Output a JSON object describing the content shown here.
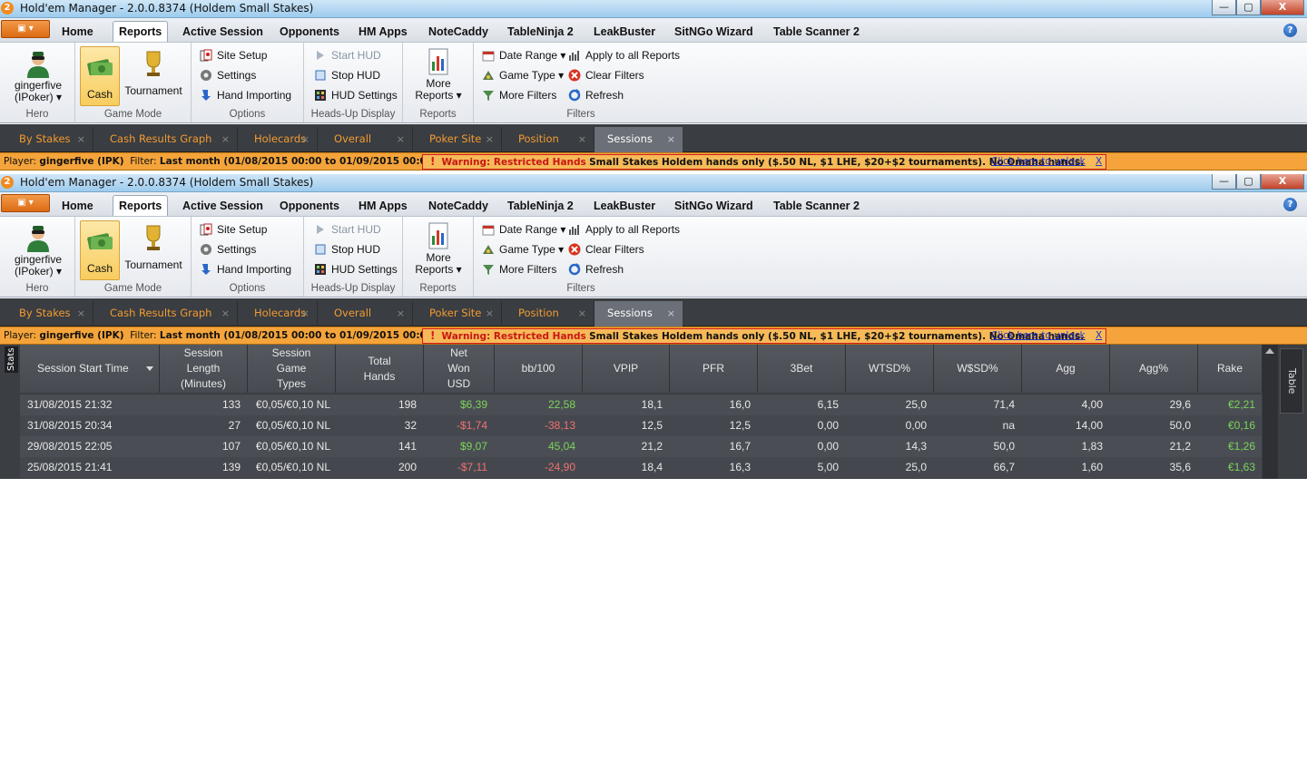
{
  "window": {
    "app_icon": "2",
    "title": "Hold'em Manager - 2.0.0.8374 (Holdem Small Stakes)",
    "minimize": "—",
    "maximize": "▢",
    "close": "X"
  },
  "menu": {
    "app_button": "▣ ▾",
    "tabs": [
      "Home",
      "Reports",
      "Active Session",
      "Opponents",
      "HM Apps",
      "NoteCaddy",
      "TableNinja 2",
      "LeakBuster",
      "SitNGo Wizard",
      "Table Scanner 2"
    ],
    "selected_tab": "Reports",
    "help": "?"
  },
  "ribbon": {
    "hero": {
      "name_line1": "gingerfive",
      "name_line2": "(IPoker) ▾",
      "label": "Hero"
    },
    "game_mode": {
      "cash": "Cash",
      "tournament": "Tournament",
      "label": "Game Mode"
    },
    "options": {
      "site_setup": "Site Setup",
      "settings": "Settings",
      "hand_importing": "Hand Importing",
      "label": "Options"
    },
    "hud": {
      "start_hud": "Start HUD",
      "stop_hud": "Stop HUD",
      "hud_settings": "HUD Settings",
      "label": "Heads-Up Display"
    },
    "reports": {
      "more_line1": "More",
      "more_line2": "Reports ▾",
      "label": "Reports"
    },
    "filters": {
      "date_range": "Date Range ▾",
      "game_type": "Game Type ▾",
      "more_filters": "More Filters",
      "apply_all": "Apply to all Reports",
      "clear_filters": "Clear Filters",
      "refresh": "Refresh",
      "label": "Filters"
    }
  },
  "doc_tabs": [
    "By Stakes",
    "Cash Results Graph",
    "Holecards",
    "Overall",
    "Poker Site",
    "Position",
    "Sessions"
  ],
  "doc_tab_close": "×",
  "filter_bar": {
    "player_label": "Player:",
    "player": "gingerfive (IPK)",
    "filter_label": "Filter:",
    "filter": "Last month (01/08/2015 00:00 to 01/09/2015 00:00)",
    "warn_icon": "!",
    "warning_title": "Warning: Restricted Hands",
    "warning_text": "Small Stakes Holdem hands only ($.50 NL, $1 LHE, $20+$2 tournaments).  No Omaha hands.",
    "unlock_link": "Click here to unlock",
    "dismiss": "X"
  },
  "grid": {
    "stats_tab": "Stats",
    "table_tab": "Table",
    "columns": [
      {
        "l1": "Session Start Time"
      },
      {
        "l1": "Session",
        "l2": "Length",
        "l3": "(Minutes)"
      },
      {
        "l1": "Session",
        "l2": "Game",
        "l3": "Types"
      },
      {
        "l1": "Total",
        "l2": "Hands"
      },
      {
        "l1": "Net",
        "l2": "Won",
        "l3": "USD"
      },
      {
        "l1": "bb/100"
      },
      {
        "l1": "VPIP"
      },
      {
        "l1": "PFR"
      },
      {
        "l1": "3Bet"
      },
      {
        "l1": "WTSD%"
      },
      {
        "l1": "W$SD%"
      },
      {
        "l1": "Agg"
      },
      {
        "l1": "Agg%"
      },
      {
        "l1": "Rake"
      }
    ],
    "rows": [
      {
        "start": "31/08/2015 21:32",
        "length": "133",
        "types": "€0,05/€0,10 NL",
        "hands": "198",
        "net": "$6,39",
        "bb100": "22,58",
        "vpip": "18,1",
        "pfr": "16,0",
        "threebet": "6,15",
        "wtsd": "25,0",
        "wsd": "71,4",
        "agg": "4,00",
        "aggp": "29,6",
        "rake": "€2,21",
        "sign": "pos"
      },
      {
        "start": "31/08/2015 20:34",
        "length": "27",
        "types": "€0,05/€0,10 NL",
        "hands": "32",
        "net": "-$1,74",
        "bb100": "-38,13",
        "vpip": "12,5",
        "pfr": "12,5",
        "threebet": "0,00",
        "wtsd": "0,00",
        "wsd": "na",
        "agg": "14,00",
        "aggp": "50,0",
        "rake": "€0,16",
        "sign": "neg"
      },
      {
        "start": "29/08/2015 22:05",
        "length": "107",
        "types": "€0,05/€0,10 NL",
        "hands": "141",
        "net": "$9,07",
        "bb100": "45,04",
        "vpip": "21,2",
        "pfr": "16,7",
        "threebet": "0,00",
        "wtsd": "14,3",
        "wsd": "50,0",
        "agg": "1,83",
        "aggp": "21,2",
        "rake": "€1,26",
        "sign": "pos"
      },
      {
        "start": "25/08/2015 21:41",
        "length": "139",
        "types": "€0,05/€0,10 NL",
        "hands": "200",
        "net": "-$7,11",
        "bb100": "-24,90",
        "vpip": "18,4",
        "pfr": "16,3",
        "threebet": "5,00",
        "wtsd": "25,0",
        "wsd": "66,7",
        "agg": "1,60",
        "aggp": "35,6",
        "rake": "€1,63",
        "sign": "neg"
      }
    ]
  },
  "colors": {
    "accent_orange": "#f29b33",
    "positive": "#7cd35b",
    "negative": "#f07272",
    "grid_bg": "#3b3e43"
  }
}
